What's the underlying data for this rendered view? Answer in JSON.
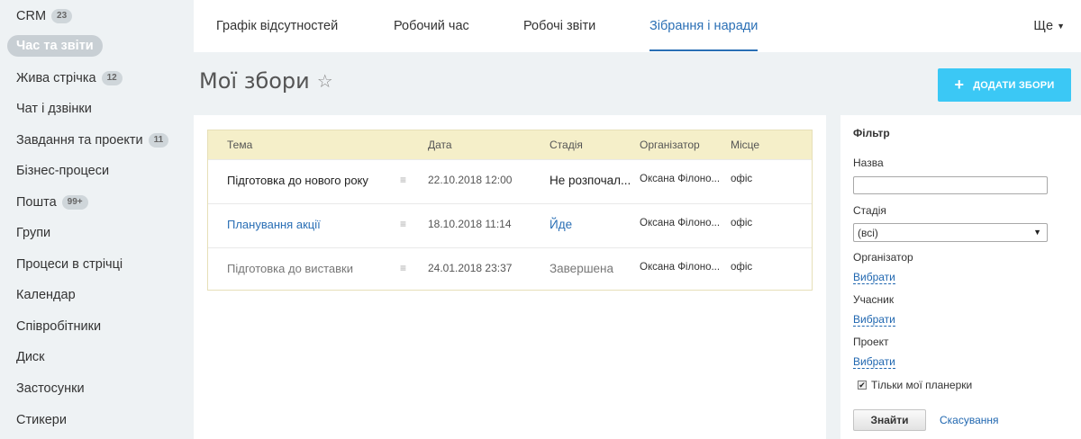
{
  "sidebar": {
    "items": [
      {
        "label": "CRM",
        "badge": "23"
      },
      {
        "label": "Час та звіти",
        "badge": ""
      },
      {
        "label": "Жива стрічка",
        "badge": "12"
      },
      {
        "label": "Чат і дзвінки",
        "badge": ""
      },
      {
        "label": "Завдання та проекти",
        "badge": "11"
      },
      {
        "label": "Бізнес-процеси",
        "badge": ""
      },
      {
        "label": "Пошта",
        "badge": "99+"
      },
      {
        "label": "Групи",
        "badge": ""
      },
      {
        "label": "Процеси в стрічці",
        "badge": ""
      },
      {
        "label": "Календар",
        "badge": ""
      },
      {
        "label": "Співробітники",
        "badge": ""
      },
      {
        "label": "Диск",
        "badge": ""
      },
      {
        "label": "Застосунки",
        "badge": ""
      },
      {
        "label": "Стикери",
        "badge": ""
      }
    ]
  },
  "nav": {
    "tabs": [
      {
        "label": "Графік відсутностей"
      },
      {
        "label": "Робочий час"
      },
      {
        "label": "Робочі звіти"
      },
      {
        "label": "Зібрання і наради"
      }
    ],
    "more_label": "Ще"
  },
  "page": {
    "title": "Мої збори",
    "add_button": "ДОДАТИ ЗБОРИ"
  },
  "grid": {
    "headers": {
      "topic": "Тема",
      "date": "Дата",
      "stage": "Стадія",
      "organizer": "Організатор",
      "place": "Місце"
    },
    "rows": [
      {
        "topic": "Підготовка до нового року",
        "date": "22.10.2018 12:00",
        "stage": "Не розпочал...",
        "organizer": "Оксана Філоно...",
        "place": "офіс"
      },
      {
        "topic": "Планування акції",
        "date": "18.10.2018 11:14",
        "stage": "Йде",
        "organizer": "Оксана Філоно...",
        "place": "офіс"
      },
      {
        "topic": "Підготовка до виставки",
        "date": "24.01.2018 23:37",
        "stage": "Завершена",
        "organizer": "Оксана Філоно...",
        "place": "офіс"
      }
    ]
  },
  "filter": {
    "title": "Фільтр",
    "name_label": "Назва",
    "name_value": "",
    "stage_label": "Стадія",
    "stage_value": "(всі)",
    "organizer_label": "Організатор",
    "participant_label": "Учасник",
    "project_label": "Проект",
    "choose_link": "Вибрати",
    "only_mine_label": "Тільки мої планерки",
    "only_mine_checked": true,
    "find_button": "Знайти",
    "cancel_link": "Скасування"
  },
  "colors": {
    "accent_blue": "#2a6fb5",
    "add_button_bg": "#3bc8f5",
    "grid_header_bg": "#f5efc9",
    "active_sidebar_bg": "#c8cfd4"
  }
}
